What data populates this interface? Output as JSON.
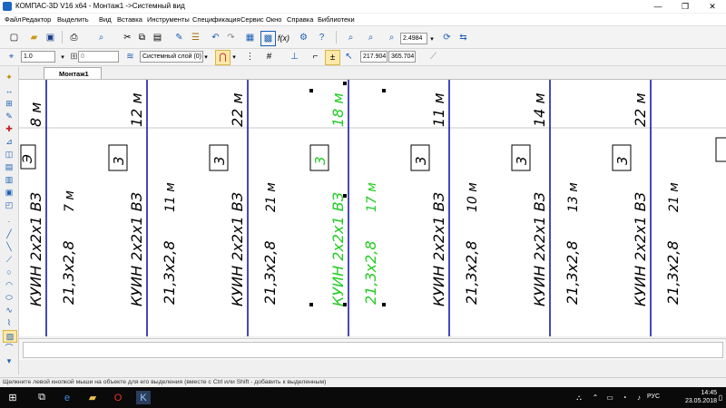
{
  "window": {
    "title": "КОМПАС-3D V16  x64 - Монтаж1 ->Системный вид",
    "minimize": "—",
    "maximize": "❐",
    "close": "✕"
  },
  "menu": [
    "Файл",
    "Редактор",
    "Выделить",
    "Вид",
    "Вставка",
    "Инструменты",
    "Спецификация",
    "Сервис",
    "Окно",
    "Справка",
    "Библиотеки"
  ],
  "toolbar": {
    "zoom_value": "2.4984"
  },
  "toolbar2": {
    "scale_value": "1.0",
    "style_value": "0",
    "layer_value": "Системный слой (0)",
    "coord_x": "217.904",
    "coord_y": "365.704"
  },
  "tabs": [
    {
      "label": "Монтаж1"
    }
  ],
  "drawing": {
    "columns": [
      {
        "id": "c0",
        "cable": "КУИН 2х2х1 ВЗ",
        "length": "7 м",
        "section": "21,3х2,8",
        "top": "8 м",
        "highlight": false,
        "num": "Э"
      },
      {
        "id": "c1",
        "cable": "КУИН 2х2х1 ВЗ",
        "length": "11 м",
        "section": "21,3х2,8",
        "top": "12 м",
        "highlight": false,
        "num": "3"
      },
      {
        "id": "c2",
        "cable": "КУИН 2х2х1 ВЗ",
        "length": "21 м",
        "section": "21,3х2,8",
        "top": "22 м",
        "highlight": false,
        "num": "3"
      },
      {
        "id": "c3",
        "cable": "КУИН 2х2х1 ВЗ",
        "length": "17 м",
        "section": "21,3х2,8",
        "top": "18 м",
        "highlight": true,
        "num": "3"
      },
      {
        "id": "c4",
        "cable": "КУИН 2х2х1 ВЗ",
        "length": "10 м",
        "section": "21,3х2,8",
        "top": "11 м",
        "highlight": false,
        "num": "3"
      },
      {
        "id": "c5",
        "cable": "КУИН 2х2х1 ВЗ",
        "length": "13 м",
        "section": "21,3х2,8",
        "top": "14 м",
        "highlight": false,
        "num": "3"
      },
      {
        "id": "c6",
        "cable": "КУИН 2х2х1 ВЗ",
        "length": "21 м",
        "section": "21,3х2,8",
        "top": "22 м",
        "highlight": false,
        "num": "3"
      }
    ],
    "highlight_color": "#22cc22",
    "line_color": "#1a1aa8",
    "ink_color": "#000000"
  },
  "statusbar": {
    "hint": "Щелкните левой кнопкой мыши на объекте для его выделения (вместе с Ctrl или Shift - добавить к выделенным)"
  },
  "taskbar": {
    "lang": "РУС",
    "time": "14:45",
    "date": "23.05.2018"
  }
}
